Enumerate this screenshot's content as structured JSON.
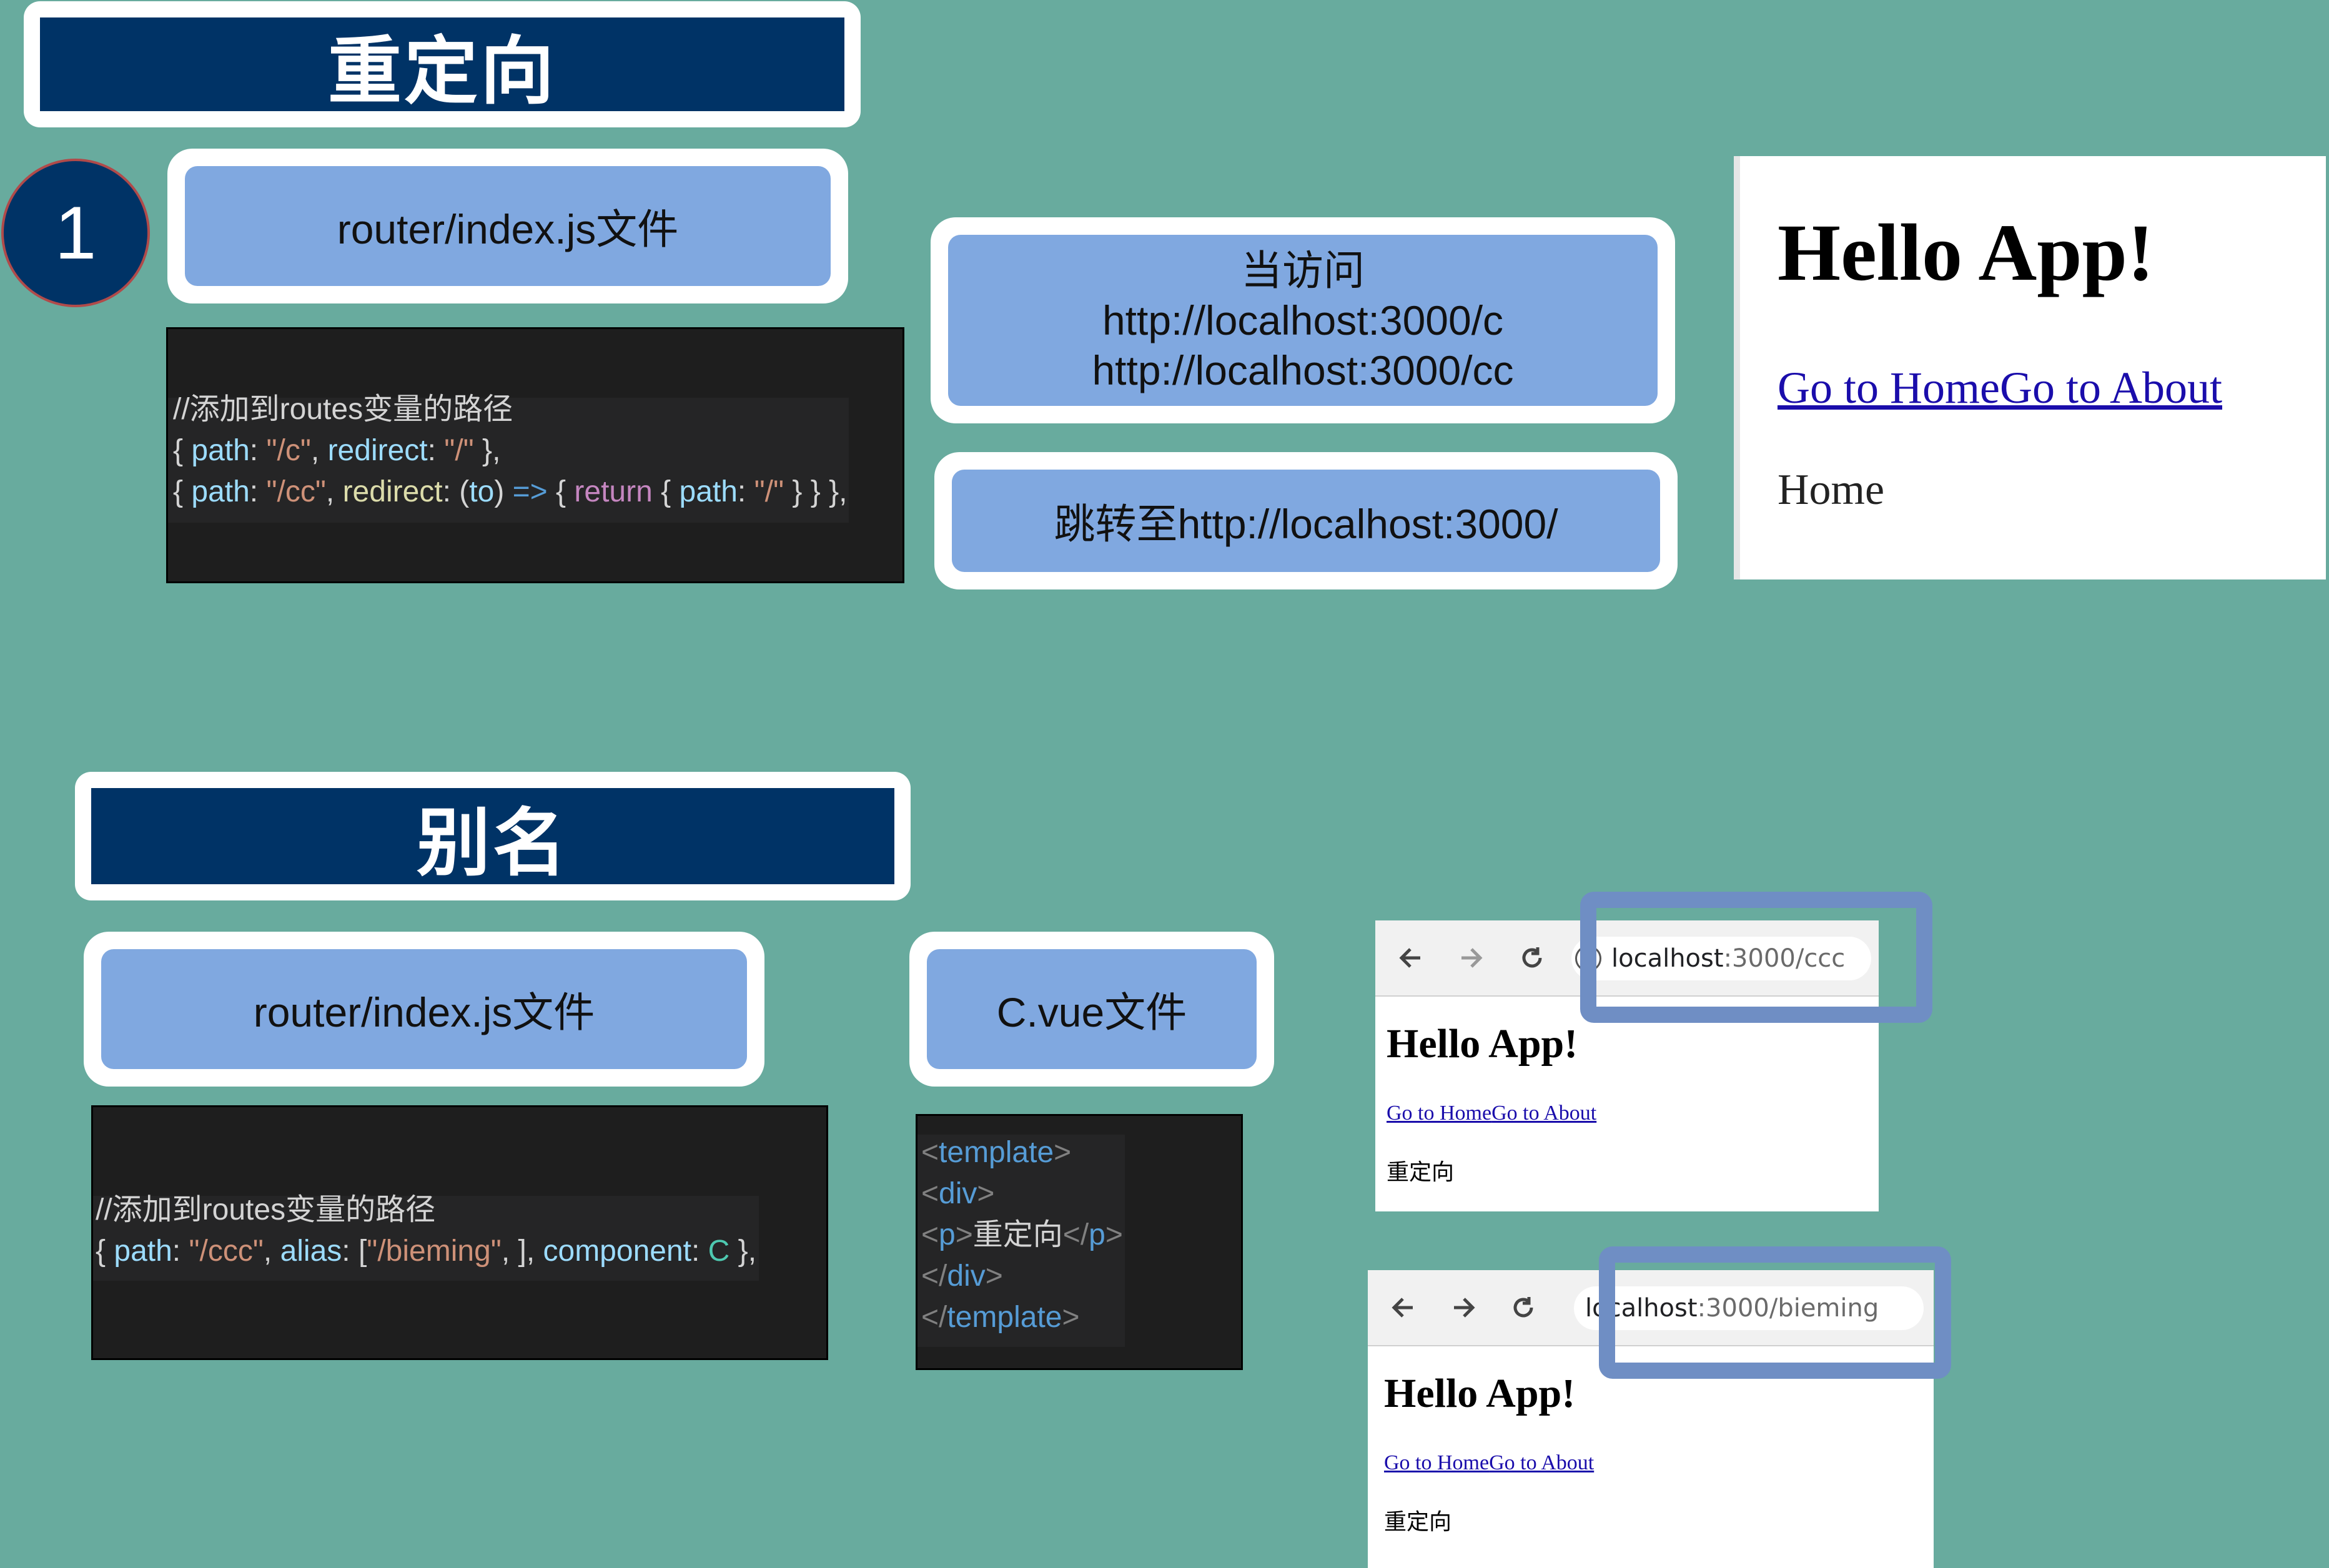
{
  "redirect_section": {
    "title": "重定向",
    "step_number": "1",
    "file_label": "router/index.js文件",
    "code_lines": [
      [
        {
          "c": "c-comment",
          "t": "//添加到routes变量的路径"
        }
      ],
      [
        {
          "c": "c-text",
          "t": "{ "
        },
        {
          "c": "c-key",
          "t": "path"
        },
        {
          "c": "c-text",
          "t": ": "
        },
        {
          "c": "c-str",
          "t": "\"/c\""
        },
        {
          "c": "c-text",
          "t": ", "
        },
        {
          "c": "c-key",
          "t": "redirect"
        },
        {
          "c": "c-text",
          "t": ": "
        },
        {
          "c": "c-str",
          "t": "\"/\""
        },
        {
          "c": "c-text",
          "t": " },"
        }
      ],
      [
        {
          "c": "c-text",
          "t": "{ "
        },
        {
          "c": "c-key",
          "t": "path"
        },
        {
          "c": "c-text",
          "t": ": "
        },
        {
          "c": "c-str",
          "t": "\"/cc\""
        },
        {
          "c": "c-text",
          "t": ", "
        },
        {
          "c": "c-fn",
          "t": "redirect"
        },
        {
          "c": "c-text",
          "t": ": ("
        },
        {
          "c": "c-key",
          "t": "to"
        },
        {
          "c": "c-text",
          "t": ") "
        },
        {
          "c": "c-op",
          "t": "=>"
        },
        {
          "c": "c-text",
          "t": " { "
        },
        {
          "c": "c-kw",
          "t": "return"
        },
        {
          "c": "c-text",
          "t": " { "
        },
        {
          "c": "c-key",
          "t": "path"
        },
        {
          "c": "c-text",
          "t": ": "
        },
        {
          "c": "c-str",
          "t": "\"/\""
        },
        {
          "c": "c-text",
          "t": " } } },"
        }
      ]
    ],
    "visit_label": {
      "line1": "当访问",
      "line2": "http://localhost:3000/c",
      "line3": "http://localhost:3000/cc"
    },
    "jump_label": "跳转至http://localhost:3000/",
    "preview": {
      "heading": "Hello App!",
      "link_home": "Go to Home",
      "link_about": "Go to About",
      "content": "Home"
    }
  },
  "alias_section": {
    "title": "别名",
    "file_label": "router/index.js文件",
    "code_lines": [
      [
        {
          "c": "c-comment",
          "t": "//添加到routes变量的路径"
        }
      ],
      [
        {
          "c": "c-text",
          "t": "{ "
        },
        {
          "c": "c-key",
          "t": "path"
        },
        {
          "c": "c-text",
          "t": ": "
        },
        {
          "c": "c-str",
          "t": "\"/ccc\""
        },
        {
          "c": "c-text",
          "t": ", "
        },
        {
          "c": "c-key",
          "t": "alias"
        },
        {
          "c": "c-text",
          "t": ": ["
        },
        {
          "c": "c-str",
          "t": "\"/bieming\""
        },
        {
          "c": "c-text",
          "t": ", ], "
        },
        {
          "c": "c-key",
          "t": "component"
        },
        {
          "c": "c-text",
          "t": ": "
        },
        {
          "c": "c-type",
          "t": "C"
        },
        {
          "c": "c-text",
          "t": " },"
        }
      ]
    ],
    "vue_file_label": "C.vue文件",
    "vue_code_lines": [
      [
        {
          "c": "c-punc",
          "t": "<"
        },
        {
          "c": "c-tagname",
          "t": "template"
        },
        {
          "c": "c-punc",
          "t": ">"
        }
      ],
      [
        {
          "c": "c-punc",
          "t": "<"
        },
        {
          "c": "c-tagname",
          "t": "div"
        },
        {
          "c": "c-punc",
          "t": ">"
        }
      ],
      [
        {
          "c": "c-punc",
          "t": "<"
        },
        {
          "c": "c-tagname",
          "t": "p"
        },
        {
          "c": "c-punc",
          "t": ">"
        },
        {
          "c": "c-text",
          "t": "重定向"
        },
        {
          "c": "c-punc",
          "t": "</"
        },
        {
          "c": "c-tagname",
          "t": "p"
        },
        {
          "c": "c-punc",
          "t": ">"
        }
      ],
      [
        {
          "c": "c-punc",
          "t": "</"
        },
        {
          "c": "c-tagname",
          "t": "div"
        },
        {
          "c": "c-punc",
          "t": ">"
        }
      ],
      [
        {
          "c": "c-punc",
          "t": "</"
        },
        {
          "c": "c-tagname",
          "t": "template"
        },
        {
          "c": "c-punc",
          "t": ">"
        }
      ]
    ],
    "browser1": {
      "url_host": "localhost",
      "url_rest": ":3000/ccc",
      "heading": "Hello App!",
      "link_home": "Go to Home",
      "link_about": "Go to About",
      "content": "重定向"
    },
    "browser2": {
      "url_host": "localhost",
      "url_rest": ":3000/bieming",
      "heading": "Hello App!",
      "link_home": "Go to Home",
      "link_about": "Go to About",
      "content": "重定向"
    }
  },
  "colors": {
    "background": "#68ab9e",
    "title_bar": "#003366",
    "pill": "#80a8e0",
    "highlight": "#6f8ec4",
    "code_bg": "#1e1e1e"
  },
  "icons": [
    "back-arrow-icon",
    "forward-arrow-icon",
    "reload-icon",
    "info-icon"
  ]
}
